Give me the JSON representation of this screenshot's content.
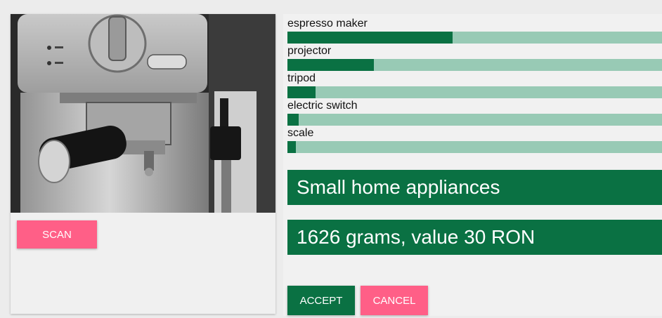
{
  "predictions": [
    {
      "label": "espresso maker",
      "score": 0.44
    },
    {
      "label": "projector",
      "score": 0.23
    },
    {
      "label": "tripod",
      "score": 0.075
    },
    {
      "label": "electric switch",
      "score": 0.03
    },
    {
      "label": "scale",
      "score": 0.023
    }
  ],
  "category": "Small home appliances",
  "estimate": "1626 grams, value 30 RON",
  "buttons": {
    "scan": "SCAN",
    "accept": "ACCEPT",
    "cancel": "CANCEL"
  },
  "colors": {
    "accent_green": "#0a7143",
    "bar_track": "#98cab5",
    "pink": "#ff5f87"
  }
}
